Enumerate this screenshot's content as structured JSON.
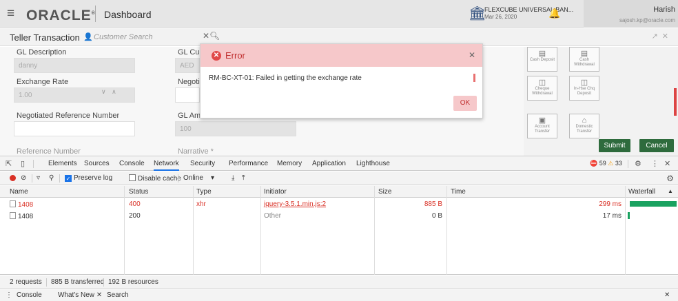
{
  "app": {
    "logo": "ORACLE",
    "page": "Dashboard",
    "bank_name": "FLEXCUBE UNIVERSAL BAN...",
    "bank_date": "Mar 26, 2020",
    "user_name": "Harish",
    "user_email": "sajosh.kp@oracle.com"
  },
  "tab": {
    "title": "Teller Transaction",
    "customer_search": "Customer Search"
  },
  "form": {
    "gl_description_label": "GL Description",
    "gl_description_value": "danny",
    "gl_currency_label": "GL Curr",
    "gl_currency_value": "AED",
    "exchange_rate_label": "Exchange Rate",
    "exchange_rate_value": "1.00",
    "negotiated_label": "Negotia",
    "negotiated_ref_label": "Negotiated Reference Number",
    "gl_amount_label": "GL Amo",
    "gl_amount_value": "100",
    "reference_number_label": "Reference Number",
    "narrative_label": "Narrative *"
  },
  "tiles": [
    {
      "label": "Cash Deposit"
    },
    {
      "label": "Cash Withdrawal"
    },
    {
      "label": "Cheque Withdrawal"
    },
    {
      "label": "In-Hse Chq Deposit"
    },
    {
      "label": "Account Transfer"
    },
    {
      "label": "Domestic Transfer"
    }
  ],
  "actions": {
    "submit": "Submit",
    "cancel": "Cancel"
  },
  "modal": {
    "title": "Error",
    "message": "RM-BC-XT-01: Failed in getting the exchange rate",
    "ok": "OK"
  },
  "devtools": {
    "tabs": [
      "Elements",
      "Sources",
      "Console",
      "Network",
      "Security",
      "Performance",
      "Memory",
      "Application",
      "Lighthouse"
    ],
    "active_tab": "Network",
    "error_count": "59",
    "warning_count": "33",
    "preserve_log": "Preserve log",
    "disable_cache": "Disable cache",
    "throttle": "Online",
    "columns": [
      "Name",
      "Status",
      "Type",
      "Initiator",
      "Size",
      "Time",
      "Waterfall"
    ],
    "rows": [
      {
        "name": "1408",
        "status": "400",
        "type": "xhr",
        "initiator": "jquery-3.5.1.min.js:2",
        "size": "885 B",
        "time": "299 ms"
      },
      {
        "name": "1408",
        "status": "200",
        "type": "",
        "initiator": "Other",
        "size": "0 B",
        "time": "17 ms"
      }
    ],
    "status": {
      "requests": "2 requests",
      "transferred": "885 B transferred",
      "resources": "192 B resources"
    },
    "drawer": {
      "console": "Console",
      "whats_new": "What's New",
      "search": "Search"
    }
  },
  "colors": {
    "accent": "#2e6b3d",
    "error": "#d93025",
    "modal_header": "#f6c8ca"
  }
}
